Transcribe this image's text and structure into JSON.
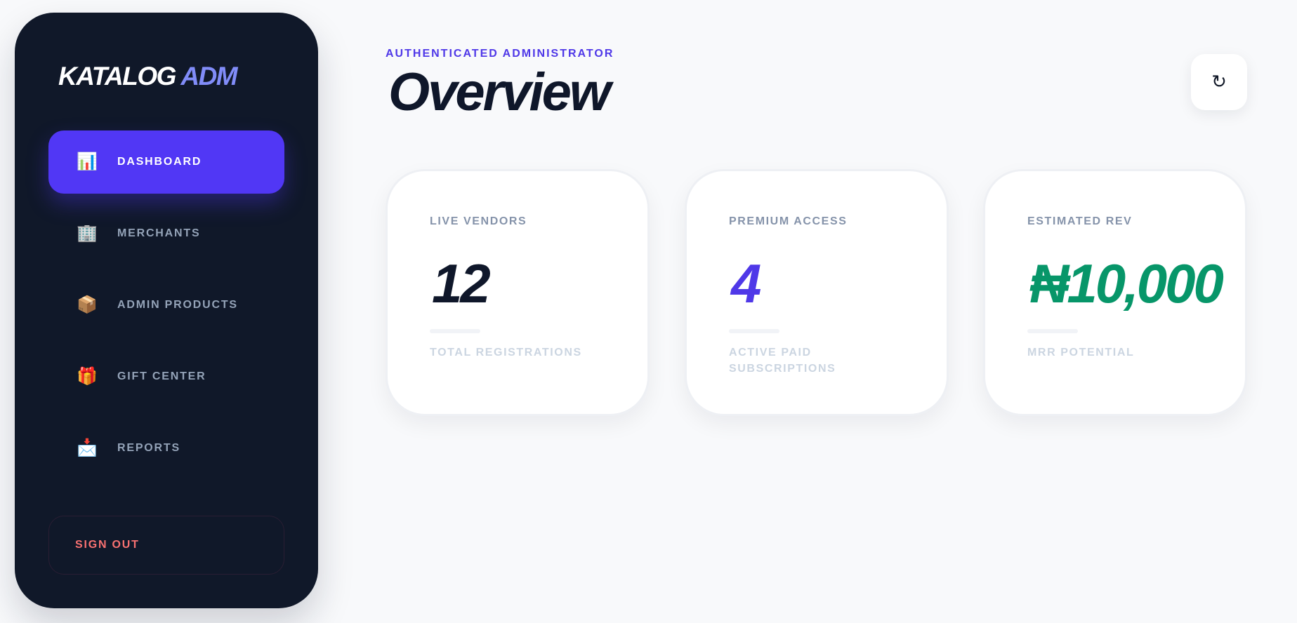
{
  "sidebar": {
    "logo_main": "KATALOG",
    "logo_accent": "ADM",
    "items": [
      {
        "label": "DASHBOARD",
        "icon": "📊",
        "icon_name": "bar-chart-icon",
        "active": true
      },
      {
        "label": "MERCHANTS",
        "icon": "🏢",
        "icon_name": "office-building-icon",
        "active": false
      },
      {
        "label": "ADMIN PRODUCTS",
        "icon": "📦",
        "icon_name": "package-icon",
        "active": false
      },
      {
        "label": "GIFT CENTER",
        "icon": "🎁",
        "icon_name": "gift-icon",
        "active": false
      },
      {
        "label": "REPORTS",
        "icon": "📩",
        "icon_name": "envelope-arrow-icon",
        "active": false
      }
    ],
    "signout_label": "SIGN OUT"
  },
  "header": {
    "eyebrow": "AUTHENTICATED ADMINISTRATOR",
    "title": "Overview",
    "refresh_icon": "↻"
  },
  "stats": [
    {
      "label": "LIVE VENDORS",
      "value": "12",
      "footnote": "TOTAL REGISTRATIONS",
      "color": "#0f172a"
    },
    {
      "label": "PREMIUM ACCESS",
      "value": "4",
      "footnote": "ACTIVE PAID SUBSCRIPTIONS",
      "color": "#4f38e8"
    },
    {
      "label": "ESTIMATED REV",
      "value": "₦10,000",
      "footnote": "MRR POTENTIAL",
      "color": "#079669"
    }
  ],
  "colors": {
    "sidebar_bg": "#101829",
    "accent": "#5137f5",
    "danger": "#f87171"
  }
}
